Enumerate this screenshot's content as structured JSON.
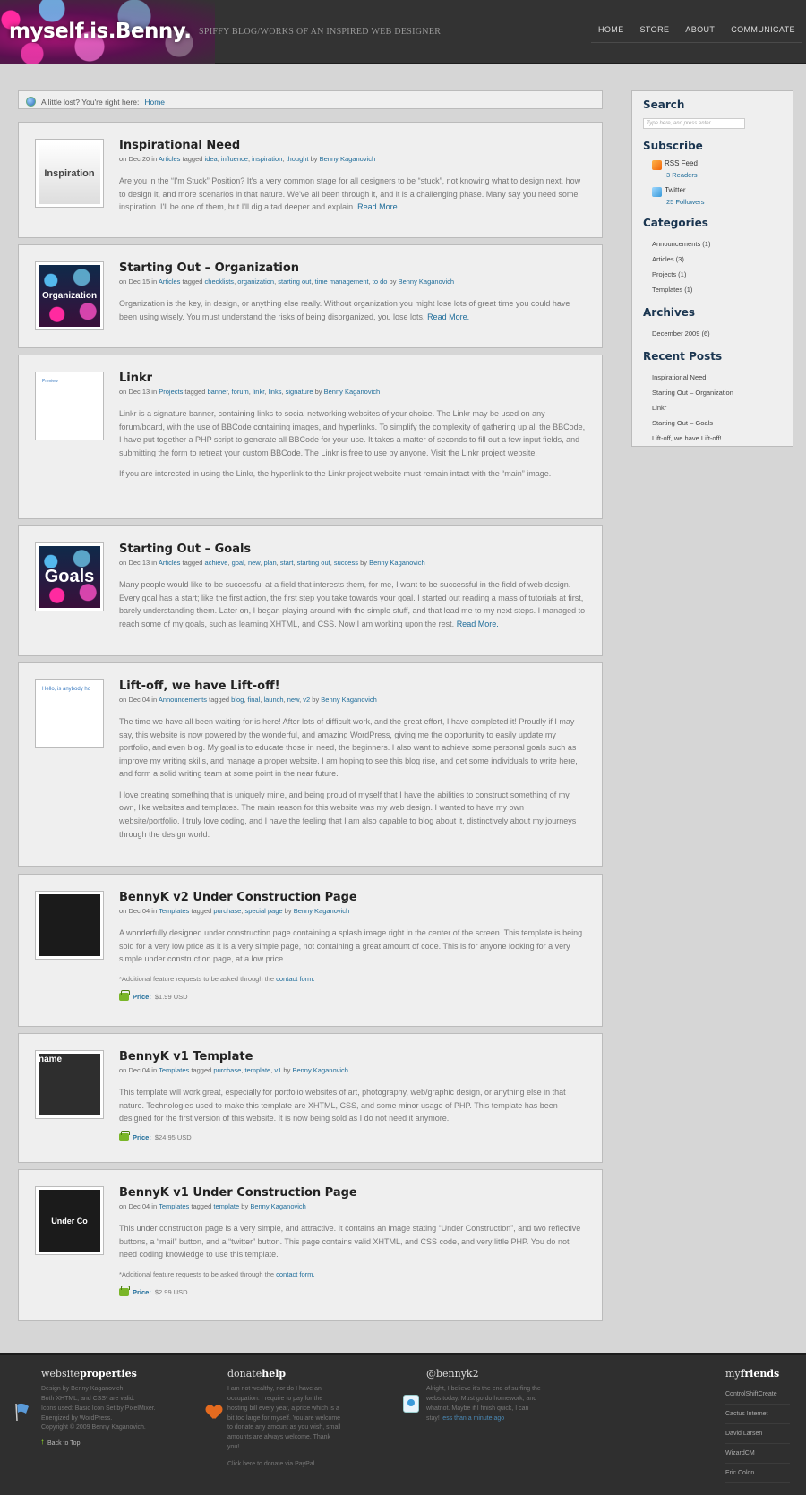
{
  "header": {
    "logo": "myself.is.Benny.",
    "tagline": "SPIFFY BLOG/WORKS OF AN INSPIRED WEB DESIGNER",
    "nav": [
      "HOME",
      "STORE",
      "ABOUT",
      "COMMUNICATE"
    ]
  },
  "breadcrumb": {
    "prefix": "A little lost? You're right here:",
    "current": "Home"
  },
  "posts": [
    {
      "title": "Inspirational Need",
      "date": "Dec 20",
      "category": "Articles",
      "tags": [
        "idea",
        "influence",
        "inspiration",
        "thought"
      ],
      "author": "Benny Kaganovich",
      "thumb": "Inspiration",
      "body": [
        "Are you in the “I'm Stuck” Position? It's a very common stage for all designers to be “stuck”, not knowing what to design next, how to design it, and more scenarios in that nature. We've all been through it, and it is a challenging phase. Many say you need some inspiration. I'll be one of them, but I'll dig a tad deeper and explain."
      ],
      "more": "Read More."
    },
    {
      "title": "Starting Out – Organization",
      "date": "Dec 15",
      "category": "Articles",
      "tags": [
        "checklists",
        "organization",
        "starting out",
        "time management",
        "to do"
      ],
      "author": "Benny Kaganovich",
      "thumb": "Organization",
      "body": [
        "Organization is the key, in design, or anything else really. Without organization you might lose lots of great time you could have been using wisely. You must understand the risks of being disorganized, you lose lots."
      ],
      "more": "Read More."
    },
    {
      "title": "Linkr",
      "date": "Dec 13",
      "category": "Projects",
      "tags": [
        "banner",
        "forum",
        "linkr",
        "links",
        "signature"
      ],
      "author": "Benny Kaganovich",
      "thumb": "Preview",
      "body": [
        "Linkr is a signature banner, containing links to social networking websites of your choice. The Linkr may be used on any forum/board, with the use of BBCode containing images, and hyperlinks. To simplify the complexity of gathering up all the BBCode, I have put together a PHP script to generate all BBCode for your use. It takes a matter of seconds to fill out a few input fields, and submitting the form to retreat your custom BBCode. The Linkr is free to use by anyone. Visit the Linkr project website.",
        "If you are interested in using the Linkr, the hyperlink to the Linkr project website must remain intact with the “main” image."
      ]
    },
    {
      "title": "Starting Out – Goals",
      "date": "Dec 13",
      "category": "Articles",
      "tags": [
        "achieve",
        "goal",
        "new",
        "plan",
        "start",
        "starting out",
        "success"
      ],
      "author": "Benny Kaganovich",
      "thumb": "Goals",
      "body": [
        "Many people would like to be successful at a field that interests them, for me, I want to be successful in the field of web design. Every goal has a start; like the first action, the first step you take towards your goal. I started out reading a mass of tutorials at first, barely understanding them. Later on, I began playing around with the simple stuff, and that lead me to my next steps. I managed to reach some of my goals, such as learning XHTML, and CSS. Now I am working upon the rest."
      ],
      "more": "Read More."
    },
    {
      "title": "Lift-off, we have Lift-off!",
      "date": "Dec 04",
      "category": "Announcements",
      "tags": [
        "blog",
        "final",
        "launch",
        "new",
        "v2"
      ],
      "author": "Benny Kaganovich",
      "thumb": "Hello, is anybody ho",
      "body": [
        "The time we have all been waiting for is here! After lots of difficult work, and the great effort, I have completed it! Proudly if I may say, this website is now powered by the wonderful, and amazing WordPress, giving me the opportunity to easily update my portfolio, and even blog. My goal is to educate those in need, the beginners. I also want to achieve some personal goals such as improve my writing skills, and manage a proper website. I am hoping to see this blog rise, and get some individuals to write here, and form a solid writing team at some point in the near future.",
        "I love creating something that is uniquely mine, and being proud of myself that I have the abilities to construct something of my own, like websites and templates. The main reason for this website was my web design. I wanted to have my own website/portfolio. I truly love coding, and I have the feeling that I am also capable to blog about it, distinctively about my journeys through the design world."
      ]
    },
    {
      "title": "BennyK v2 Under Construction Page",
      "date": "Dec 04",
      "category": "Templates",
      "tags": [
        "purchase",
        "special page"
      ],
      "author": "Benny Kaganovich",
      "thumb": "",
      "body": [
        "A wonderfully designed under construction page containing a splash image right in the center of the screen. This template is being sold for a very low price as it is a very simple page, not containing a great amount of code. This is for anyone looking for a very simple under construction page, at a low price."
      ],
      "note": "*Additional feature requests to be asked through the",
      "note_link": "contact form.",
      "price_label": "Price:",
      "price": "$1.99 USD"
    },
    {
      "title": "BennyK v1 Template",
      "date": "Dec 04",
      "category": "Templates",
      "tags": [
        "purchase",
        "template",
        "v1"
      ],
      "author": "Benny Kaganovich",
      "thumb": "name",
      "body": [
        "This template will work great, especially for portfolio websites of art, photography, web/graphic design, or anything else in that nature. Technologies used to make this template are XHTML, CSS, and some minor usage of PHP. This template has been designed for the first version of this website. It is now being sold as I do not need it anymore."
      ],
      "price_label": "Price:",
      "price": "$24.95 USD"
    },
    {
      "title": "BennyK v1 Under Construction Page",
      "date": "Dec 04",
      "category": "Templates",
      "tags": [
        "template"
      ],
      "author": "Benny Kaganovich",
      "thumb": "Under Co",
      "body": [
        "This under construction page is a very simple, and attractive. It contains an image stating “Under Construction”, and two reflective buttons, a “mail” button, and a “twitter” button. This page contains valid XHTML, and CSS code, and very little PHP. You do not need coding knowledge to use this template."
      ],
      "note": "*Additional feature requests to be asked through the",
      "note_link": "contact form.",
      "price_label": "Price:",
      "price": "$2.99 USD"
    }
  ],
  "meta_words": {
    "on": "on",
    "in": "in",
    "tagged": "tagged",
    "by": "by"
  },
  "sidebar": {
    "search_title": "Search",
    "search_placeholder": "Type here, and press enter...",
    "subscribe_title": "Subscribe",
    "rss": {
      "name": "RSS Feed",
      "count": "3 Readers"
    },
    "twitter": {
      "name": "Twitter",
      "count": "25 Followers"
    },
    "categories_title": "Categories",
    "categories": [
      "Announcements (1)",
      "Articles (3)",
      "Projects (1)",
      "Templates (1)"
    ],
    "archives_title": "Archives",
    "archives": [
      "December 2009 (6)"
    ],
    "recent_title": "Recent Posts",
    "recent": [
      "Inspirational Need",
      "Starting Out – Organization",
      "Linkr",
      "Starting Out – Goals",
      "Lift-off, we have Lift-off!"
    ]
  },
  "footer": {
    "props_title_a": "website",
    "props_title_b": "properties",
    "props_lines": [
      "Design by Benny Kaganovich.",
      "Both XHTML, and CSS³ are valid.",
      "Icons used: Basic Icon Set by PixelMixer.",
      "Energized by WordPress.",
      "Copyright © 2009 Benny Kaganovich."
    ],
    "back_to_top": "Back to Top",
    "donate_title_a": "donate",
    "donate_title_b": "help",
    "donate_text": "I am not wealthy, nor do I have an occupation. I require to pay for the hosting bill every year, a price which is a bit too large for myself. You are welcome to donate any amount as you wish, small amounts are always welcome. Thank you!",
    "donate_link": "Click here to donate via PayPal.",
    "twitter_title": "@bennyk2",
    "twitter_text": "Alright, I believe it's the end of surfing the webs today. Must go do homework, and whatnot. Maybe if I finish quick, I can stay!",
    "twitter_time": "less than a minute ago",
    "friends_title_a": "my",
    "friends_title_b": "friends",
    "friends": [
      "ControlShiftCreate",
      "Cactus Internet",
      "David Larsen",
      "WizardCM",
      "Eric Colon"
    ]
  }
}
